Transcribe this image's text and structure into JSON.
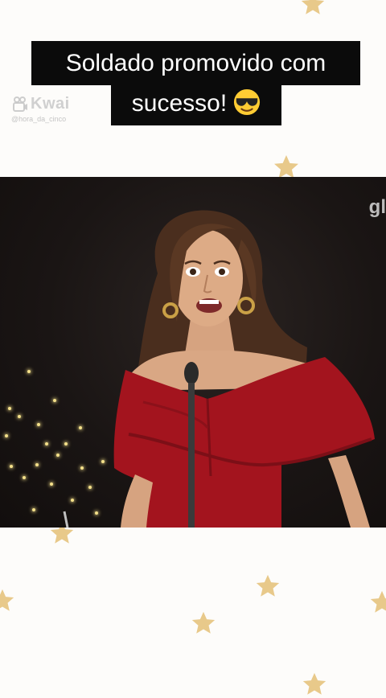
{
  "caption": {
    "line1": "Soldado promovido com",
    "line2": "sucesso!",
    "emoji": "smiling-face-with-sunglasses"
  },
  "watermark": {
    "brand": "Kwai",
    "handle": "@hora_da_cinco"
  },
  "video": {
    "channel_logo": "gl"
  },
  "colors": {
    "page_background": "#fdfcfa",
    "star": "#e8c98a",
    "caption_background": "#0b0b0b",
    "caption_text": "#ffffff",
    "dress": "#a3141e"
  }
}
